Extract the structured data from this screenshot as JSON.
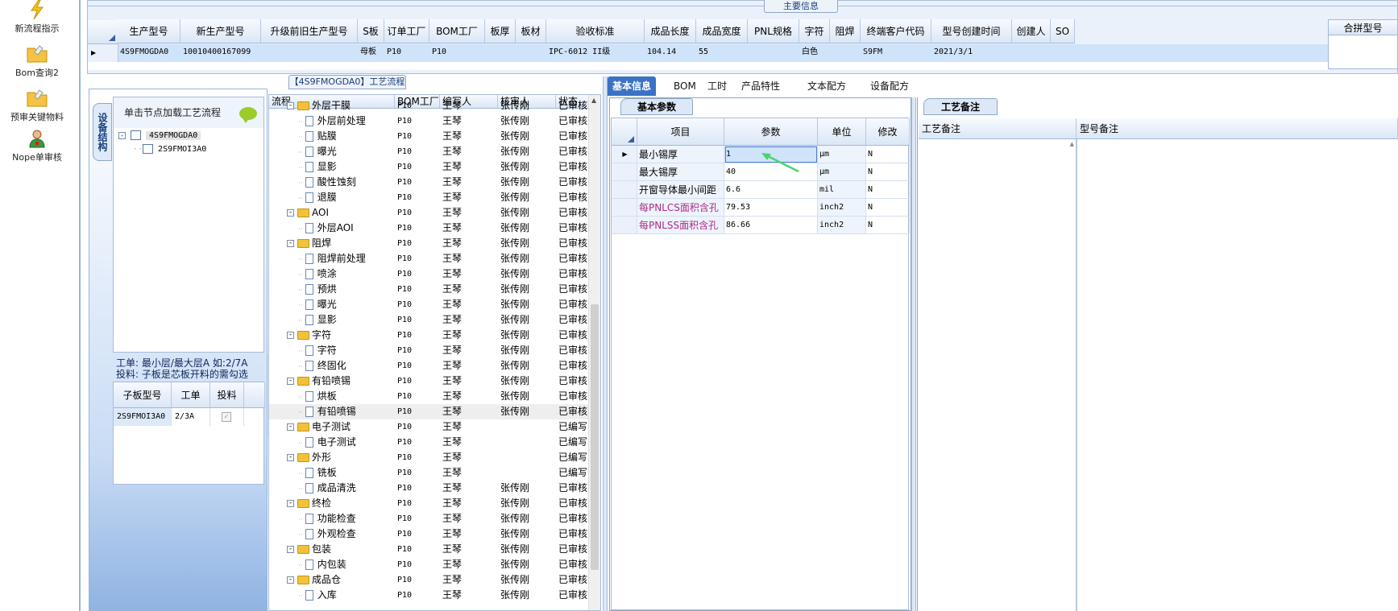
{
  "sidebar": {
    "items": [
      {
        "label": "新流程指示",
        "icon": "lightning-icon"
      },
      {
        "label": "Bom查询2",
        "icon": "folder-icon"
      },
      {
        "label": "预审关键物料",
        "icon": "folder-icon"
      },
      {
        "label": "Nope单审核",
        "icon": "user-icon"
      }
    ]
  },
  "main_info": {
    "caption": "主要信息",
    "columns": [
      "生产型号",
      "新生产型号",
      "升级前旧生产型号",
      "S板",
      "订单工厂",
      "BOM工厂",
      "板厚",
      "板材",
      "验收标准",
      "成品长度",
      "成品宽度",
      "PNL规格",
      "字符",
      "阻焊",
      "终端客户代码",
      "型号创建时间",
      "创建人",
      "SO"
    ],
    "row": [
      "4S9FMOGDA0",
      "10010400167099",
      "",
      "母板",
      "P10",
      "P10",
      "",
      "",
      "IPC-6012 II级",
      "104.14",
      "55",
      "",
      "白色",
      "",
      "S9FM",
      "2021/3/1",
      "",
      ""
    ],
    "merge_header": "合拼型号"
  },
  "process_tree": {
    "header": "单击节点加载工艺流程",
    "vertical_tab": "设备结构",
    "nodes": [
      "4S9FMOGDA0",
      "2S9FMOI3A0"
    ],
    "info_line1": "工单: 最小层/最大层A 如:2/7A",
    "info_line2": "投料: 子板是芯板开料的需勾选",
    "sub_columns": [
      "子板型号",
      "工单",
      "投料"
    ],
    "sub_row": [
      "2S9FMOI3A0",
      "2/3A"
    ]
  },
  "process_flow": {
    "title": "【4S9FMOGDA0】工艺流程",
    "columns": [
      "流程",
      "BOM工厂",
      "编写人",
      "核审人",
      "状态"
    ],
    "rows": [
      {
        "level": 1,
        "name": "外层干膜",
        "bom": "P10",
        "writer": "王琴",
        "reviewer": "张传刚",
        "status": "已审核"
      },
      {
        "level": 2,
        "name": "外层前处理",
        "bom": "P10",
        "writer": "王琴",
        "reviewer": "张传刚",
        "status": "已审核"
      },
      {
        "level": 2,
        "name": "贴膜",
        "bom": "P10",
        "writer": "王琴",
        "reviewer": "张传刚",
        "status": "已审核"
      },
      {
        "level": 2,
        "name": "曝光",
        "bom": "P10",
        "writer": "王琴",
        "reviewer": "张传刚",
        "status": "已审核"
      },
      {
        "level": 2,
        "name": "显影",
        "bom": "P10",
        "writer": "王琴",
        "reviewer": "张传刚",
        "status": "已审核"
      },
      {
        "level": 2,
        "name": "酸性蚀刻",
        "bom": "P10",
        "writer": "王琴",
        "reviewer": "张传刚",
        "status": "已审核"
      },
      {
        "level": 2,
        "name": "退膜",
        "bom": "P10",
        "writer": "王琴",
        "reviewer": "张传刚",
        "status": "已审核"
      },
      {
        "level": 1,
        "name": "AOI",
        "bom": "P10",
        "writer": "王琴",
        "reviewer": "张传刚",
        "status": "已审核"
      },
      {
        "level": 2,
        "name": "外层AOI",
        "bom": "P10",
        "writer": "王琴",
        "reviewer": "张传刚",
        "status": "已审核"
      },
      {
        "level": 1,
        "name": "阻焊",
        "bom": "P10",
        "writer": "王琴",
        "reviewer": "张传刚",
        "status": "已审核"
      },
      {
        "level": 2,
        "name": "阻焊前处理",
        "bom": "P10",
        "writer": "王琴",
        "reviewer": "张传刚",
        "status": "已审核"
      },
      {
        "level": 2,
        "name": "喷涂",
        "bom": "P10",
        "writer": "王琴",
        "reviewer": "张传刚",
        "status": "已审核"
      },
      {
        "level": 2,
        "name": "预烘",
        "bom": "P10",
        "writer": "王琴",
        "reviewer": "张传刚",
        "status": "已审核"
      },
      {
        "level": 2,
        "name": "曝光",
        "bom": "P10",
        "writer": "王琴",
        "reviewer": "张传刚",
        "status": "已审核"
      },
      {
        "level": 2,
        "name": "显影",
        "bom": "P10",
        "writer": "王琴",
        "reviewer": "张传刚",
        "status": "已审核"
      },
      {
        "level": 1,
        "name": "字符",
        "bom": "P10",
        "writer": "王琴",
        "reviewer": "张传刚",
        "status": "已审核"
      },
      {
        "level": 2,
        "name": "字符",
        "bom": "P10",
        "writer": "王琴",
        "reviewer": "张传刚",
        "status": "已审核"
      },
      {
        "level": 2,
        "name": "终固化",
        "bom": "P10",
        "writer": "王琴",
        "reviewer": "张传刚",
        "status": "已审核"
      },
      {
        "level": 1,
        "name": "有铅喷锡",
        "bom": "P10",
        "writer": "王琴",
        "reviewer": "张传刚",
        "status": "已审核"
      },
      {
        "level": 2,
        "name": "烘板",
        "bom": "P10",
        "writer": "王琴",
        "reviewer": "张传刚",
        "status": "已审核"
      },
      {
        "level": 2,
        "name": "有铅喷锡",
        "bom": "P10",
        "writer": "王琴",
        "reviewer": "张传刚",
        "status": "已审核",
        "selected": true
      },
      {
        "level": 1,
        "name": "电子测试",
        "bom": "P10",
        "writer": "王琴",
        "reviewer": "",
        "status": "已编写"
      },
      {
        "level": 2,
        "name": "电子测试",
        "bom": "P10",
        "writer": "王琴",
        "reviewer": "",
        "status": "已编写"
      },
      {
        "level": 1,
        "name": "外形",
        "bom": "P10",
        "writer": "王琴",
        "reviewer": "",
        "status": "已编写"
      },
      {
        "level": 2,
        "name": "铣板",
        "bom": "P10",
        "writer": "王琴",
        "reviewer": "",
        "status": "已编写"
      },
      {
        "level": 2,
        "name": "成品清洗",
        "bom": "P10",
        "writer": "王琴",
        "reviewer": "张传刚",
        "status": "已审核"
      },
      {
        "level": 1,
        "name": "终检",
        "bom": "P10",
        "writer": "王琴",
        "reviewer": "张传刚",
        "status": "已审核"
      },
      {
        "level": 2,
        "name": "功能检查",
        "bom": "P10",
        "writer": "王琴",
        "reviewer": "张传刚",
        "status": "已审核"
      },
      {
        "level": 2,
        "name": "外观检查",
        "bom": "P10",
        "writer": "王琴",
        "reviewer": "张传刚",
        "status": "已审核"
      },
      {
        "level": 1,
        "name": "包装",
        "bom": "P10",
        "writer": "王琴",
        "reviewer": "张传刚",
        "status": "已审核"
      },
      {
        "level": 2,
        "name": "内包装",
        "bom": "P10",
        "writer": "王琴",
        "reviewer": "张传刚",
        "status": "已审核"
      },
      {
        "level": 1,
        "name": "成品仓",
        "bom": "P10",
        "writer": "王琴",
        "reviewer": "张传刚",
        "status": "已审核"
      },
      {
        "level": 2,
        "name": "入库",
        "bom": "P10",
        "writer": "王琴",
        "reviewer": "张传刚",
        "status": "已审核"
      }
    ]
  },
  "tabs": [
    "基本信息",
    "BOM",
    "工时",
    "产品特性",
    "文本配方",
    "设备配方"
  ],
  "basic_params": {
    "tab_label": "基本参数",
    "columns": [
      "项目",
      "参数",
      "单位",
      "修改"
    ],
    "rows": [
      {
        "item": "最小锡厚",
        "value": "1",
        "unit": "μm",
        "modify": "N",
        "highlight": false
      },
      {
        "item": "最大锡厚",
        "value": "40",
        "unit": "μm",
        "modify": "N",
        "highlight": false
      },
      {
        "item": "开窗导体最小间距",
        "value": "6.6",
        "unit": "mil",
        "modify": "N",
        "highlight": false
      },
      {
        "item": "每PNLCS面积含孔",
        "value": "79.53",
        "unit": "inch2",
        "modify": "N",
        "highlight": true
      },
      {
        "item": "每PNLSS面积含孔",
        "value": "86.66",
        "unit": "inch2",
        "modify": "N",
        "highlight": true
      }
    ],
    "highlight_color": "#b02a8a"
  },
  "process_notes": {
    "tab_label": "工艺备注",
    "columns": [
      "工艺备注",
      "型号备注"
    ]
  }
}
